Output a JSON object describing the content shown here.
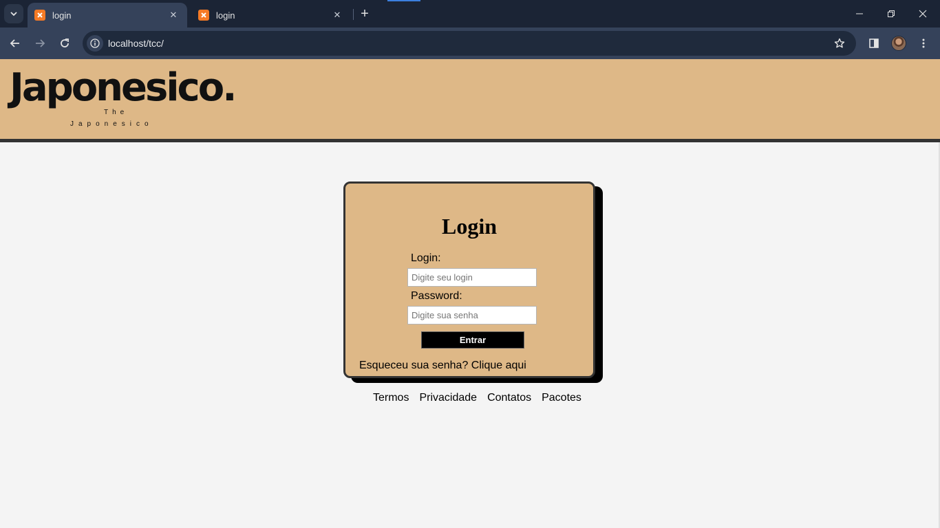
{
  "browser": {
    "tabs": [
      {
        "title": "login",
        "active": true
      },
      {
        "title": "login",
        "active": false
      }
    ],
    "url": "localhost/tcc/"
  },
  "header": {
    "logo_text": "Japonesico.",
    "logo_the": "The",
    "logo_subtitle": "Japonesico"
  },
  "login_form": {
    "title": "Login",
    "login_label": "Login:",
    "login_placeholder": "Digite seu login",
    "password_label": "Password:",
    "password_placeholder": "Digite sua senha",
    "submit_label": "Entrar",
    "forgot_text": "Esqueceu sua senha? Clique aqui"
  },
  "footer": {
    "links": [
      "Termos",
      "Privacidade",
      "Contatos",
      "Pacotes"
    ]
  },
  "colors": {
    "header_bg": "#deb887",
    "page_bg": "#f4f4f4",
    "chrome_bg": "#1b2435"
  }
}
